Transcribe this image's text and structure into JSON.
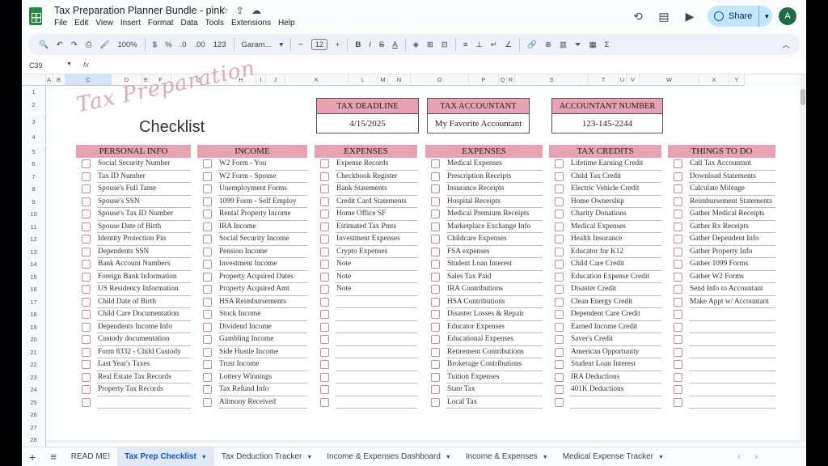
{
  "doc": {
    "title": "Tax Preparation Planner Bundle - pink"
  },
  "title_icons": [
    "star-icon",
    "move-icon",
    "cloud-icon"
  ],
  "menu": [
    "File",
    "Edit",
    "View",
    "Insert",
    "Format",
    "Data",
    "Tools",
    "Extensions",
    "Help"
  ],
  "share_label": "Share",
  "avatar_letter": "A",
  "toolbar": {
    "zoom": "100%",
    "currency": "$",
    "percent": "%",
    "decimals": "123",
    "font": "Garam...",
    "font_size": "12",
    "bold": "B",
    "italic": "I",
    "strike": "S",
    "textcolor": "A",
    "sigma": "Σ"
  },
  "formula": {
    "cell": "C39",
    "fx": "fx",
    "value": ""
  },
  "columns": [
    "A",
    "B",
    "C",
    "D",
    "E",
    "F",
    "G",
    "H",
    "I",
    "J",
    "K",
    "L",
    "M",
    "N",
    "O",
    "P",
    "Q",
    "R",
    "S",
    "T",
    "U",
    "V",
    "W",
    "X",
    "Y"
  ],
  "rows": [
    "1",
    "2",
    "3",
    "4",
    "5",
    "6",
    "7",
    "8",
    "9",
    "10",
    "11",
    "12",
    "13",
    "14",
    "15",
    "16",
    "17",
    "18",
    "19",
    "20",
    "21",
    "22",
    "23",
    "24",
    "25",
    "26",
    "27",
    "28"
  ],
  "header": {
    "script": "Tax Preparation",
    "checklist": "Checklist"
  },
  "key_boxes": [
    {
      "label": "TAX DEADLINE",
      "value": "4/15/2025"
    },
    {
      "label": "TAX ACCOUNTANT",
      "value": "My Favorite Accountant"
    },
    {
      "label": "ACCOUNTANT NUMBER",
      "value": "123-145-2244"
    }
  ],
  "sections": [
    {
      "title": "PERSONAL INFO",
      "items": [
        "Social Security Number",
        "Tax ID Number",
        "Spouse's Full Tame",
        "Spouse's SSN",
        "Spouse's Tax ID Number",
        "Spouse Date of Birth",
        "Identity Protection Pin",
        "Dependents SSN",
        "Bank Account Numbers",
        "Foreign Bank Information",
        "US Residency Information",
        "Child Date of Birth",
        "Child Care Documentation",
        "Dependents Income Info",
        "Custody documentation",
        "Form 8332 - Child Custody",
        "Last Year's Taxes",
        "Real Estate Tax Records",
        "Property Tax Records",
        ""
      ]
    },
    {
      "title": "INCOME",
      "items": [
        "W2 Form - You",
        "W2 Form - Spouse",
        "Unemployment Forms",
        "1099 Form - Self Employ",
        "Rental Property Income",
        "IRA Income",
        "Social Security Income",
        "Pension Income",
        "Investment Income",
        "Property Acquired Dates",
        "Property Acquired Amt",
        "HSA Reimbursements",
        "Stock Income",
        "Dividend Income",
        "Gambling Income",
        "Side Hustle Income",
        "Trust Income",
        "Lottery Winnings",
        "Tax Refund Info",
        "Alimony Received"
      ]
    },
    {
      "title": "EXPENSES",
      "items": [
        "Expense Records",
        "Checkbook Register",
        "Bank Statements",
        "Credit Card Statements",
        "Home Office SF",
        "Estimated Tax Pmts",
        "Investment Expenses",
        "Crypto Expenses",
        "Note",
        "Note",
        "Note",
        "",
        "",
        "",
        "",
        "",
        "",
        "",
        "",
        ""
      ]
    },
    {
      "title": "EXPENSES",
      "items": [
        "Medical Expenses",
        "Prescription Receipts",
        "Insurance Receipts",
        "Hospital Receipts",
        "Medical Premium Receipts",
        "Marketplace Exchange Info",
        "Childcare Expenses",
        "FSA expenses",
        "Student Loan Interest",
        "Sales Tax Paid",
        "IRA Contributions",
        "HSA Contributions",
        "Disaster Losses & Repair",
        "Educator Expenses",
        "Educational Expenses",
        "Retirement Contributions",
        "Brokerage Contributions",
        "Tuition Expenses",
        "State Tax",
        "Local Tax"
      ]
    },
    {
      "title": "TAX CREDITS",
      "items": [
        "Lifetime Earning Credit",
        "Child Tax Credit",
        "Electric Vehicle Credit",
        "Home Ownership",
        "Charity Donations",
        "Medical Expenses",
        "Health Insurance",
        "Educator for K12",
        "Child Care Credit",
        "Education Expense Credit",
        "Disaster Credit",
        "Clean Energy Credit",
        "Dependent Care Credit",
        "Earned Income Credit",
        "Saver's Credit",
        "American Opportunity",
        "Student Loan Interest",
        "IRA Deductions",
        "401K Deductions",
        ""
      ]
    },
    {
      "title": "THINGS TO DO",
      "items": [
        "Call Tax Accountant",
        "Download Statements",
        "Calculate Mileage",
        "Reimbursement Statements",
        "Gather Medical Receipts",
        "Gather Rx Receipts",
        "Gather Dependent Info",
        "Gather Property Info",
        "Gather 1099 Forms",
        "Gather W2 Forms",
        "Send Info to Accountant",
        "Make Appt w/ Accountant",
        "",
        "",
        "",
        "",
        "",
        "",
        "",
        ""
      ]
    }
  ],
  "tabs": [
    {
      "label": "READ ME!",
      "active": false
    },
    {
      "label": "Tax Prep Checklist",
      "active": true
    },
    {
      "label": "Tax Deduction Tracker",
      "active": false
    },
    {
      "label": "Income & Expenses Dashboard",
      "active": false
    },
    {
      "label": "Income & Expenses",
      "active": false
    },
    {
      "label": "Medical Expense Tracker",
      "active": false
    }
  ]
}
